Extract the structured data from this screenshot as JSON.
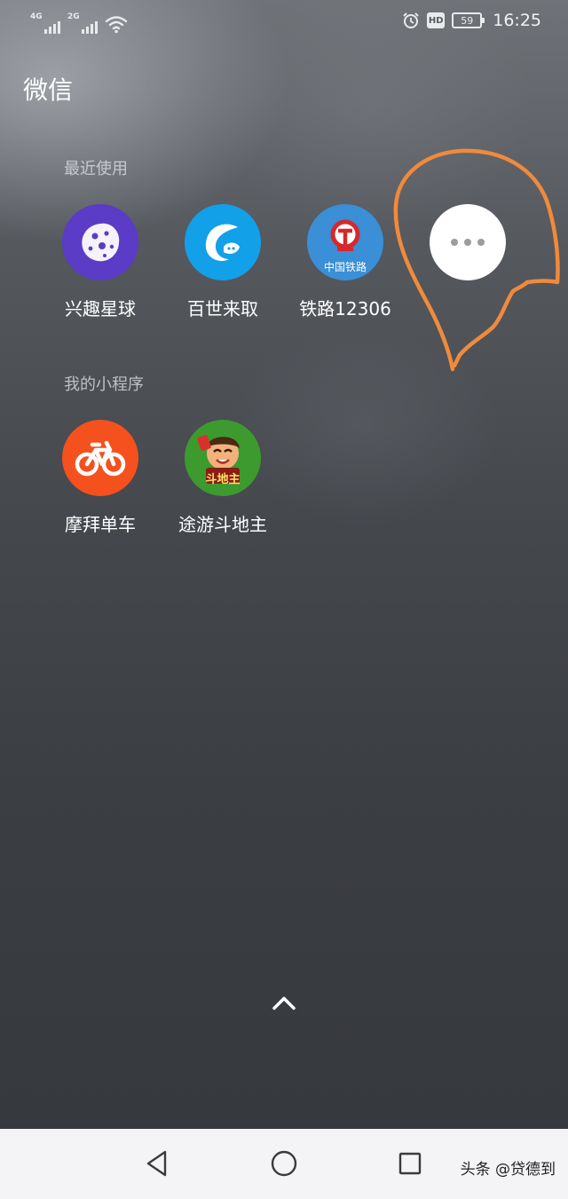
{
  "status_bar": {
    "network_1": "4G",
    "network_2": "2G",
    "hd_badge": "HD",
    "battery_level": "59",
    "time": "16:25",
    "icons": [
      "signal-icon",
      "wifi-icon",
      "alarm-icon",
      "hd-icon",
      "battery-icon"
    ]
  },
  "app_title": "微信",
  "recent": {
    "title": "最近使用",
    "items": [
      {
        "label": "兴趣星球",
        "icon": "planet-icon",
        "color": "#5a3cc6"
      },
      {
        "label": "百世来取",
        "icon": "best-express-icon",
        "color": "#12a0e8"
      },
      {
        "label": "铁路12306",
        "icon": "railway-icon",
        "color": "#3a8fd6",
        "icon_text": "中国铁路"
      },
      {
        "label": "",
        "icon": "more-icon",
        "color": "#ffffff"
      }
    ]
  },
  "mine": {
    "title": "我的小程序",
    "items": [
      {
        "label": "摩拜单车",
        "icon": "bicycle-icon",
        "color": "#f4511e"
      },
      {
        "label": "途游斗地主",
        "icon": "doudizhu-game-icon",
        "color": "#3c9a2e",
        "icon_text": "斗地主"
      }
    ]
  },
  "annotation_color": "#f08a3c",
  "navigation": {
    "icons": [
      "back-icon",
      "home-icon",
      "recents-icon",
      "swipe-up-icon"
    ]
  },
  "watermark": "头条 @贷德到"
}
